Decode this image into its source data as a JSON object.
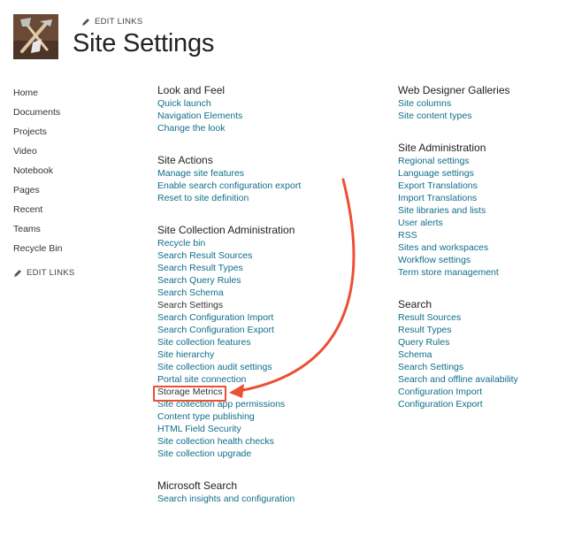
{
  "header": {
    "edit_links_label": "EDIT LINKS",
    "title": "Site Settings"
  },
  "left_nav": {
    "items": [
      {
        "label": "Home"
      },
      {
        "label": "Documents"
      },
      {
        "label": "Projects"
      },
      {
        "label": "Video"
      },
      {
        "label": "Notebook"
      },
      {
        "label": "Pages"
      },
      {
        "label": "Recent"
      },
      {
        "label": "Teams"
      },
      {
        "label": "Recycle Bin"
      }
    ],
    "edit_links_label": "EDIT LINKS"
  },
  "sections": {
    "look_and_feel": {
      "heading": "Look and Feel",
      "links": [
        "Quick launch",
        "Navigation Elements",
        "Change the look"
      ]
    },
    "site_actions": {
      "heading": "Site Actions",
      "links": [
        "Manage site features",
        "Enable search configuration export",
        "Reset to site definition"
      ]
    },
    "site_collection_administration": {
      "heading": "Site Collection Administration",
      "links": [
        "Recycle bin",
        "Search Result Sources",
        "Search Result Types",
        "Search Query Rules",
        "Search Schema",
        "Search Settings",
        "Search Configuration Import",
        "Search Configuration Export",
        "Site collection features",
        "Site hierarchy",
        "Site collection audit settings",
        "Portal site connection",
        "Storage Metrics",
        "Site collection app permissions",
        "Content type publishing",
        "HTML Field Security",
        "Site collection health checks",
        "Site collection upgrade"
      ]
    },
    "microsoft_search": {
      "heading": "Microsoft Search",
      "links": [
        "Search insights and configuration"
      ]
    },
    "web_designer_galleries": {
      "heading": "Web Designer Galleries",
      "links": [
        "Site columns",
        "Site content types"
      ]
    },
    "site_administration": {
      "heading": "Site Administration",
      "links": [
        "Regional settings",
        "Language settings",
        "Export Translations",
        "Import Translations",
        "Site libraries and lists",
        "User alerts",
        "RSS",
        "Sites and workspaces",
        "Workflow settings",
        "Term store management"
      ]
    },
    "search": {
      "heading": "Search",
      "links": [
        "Result Sources",
        "Result Types",
        "Query Rules",
        "Schema",
        "Search Settings",
        "Search and offline availability",
        "Configuration Import",
        "Configuration Export"
      ]
    }
  },
  "annotation": {
    "color": "#ec4f34",
    "highlighted_link": "Storage Metrics"
  },
  "colors": {
    "link": "#0f6e8a",
    "logo_bg": "#6b4a35"
  }
}
